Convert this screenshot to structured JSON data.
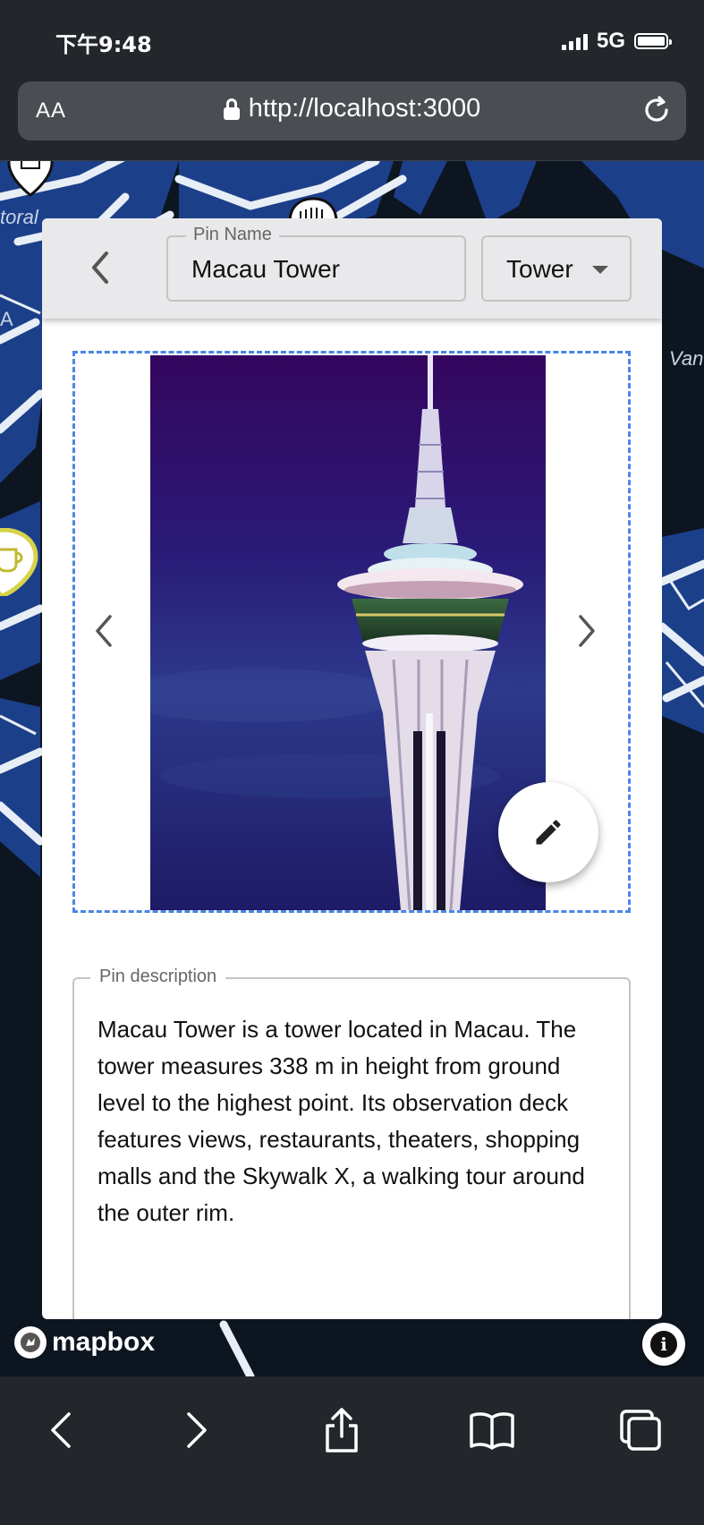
{
  "status_bar": {
    "time": "下午9:48",
    "network": "5G"
  },
  "browser": {
    "text_size_label": "AA",
    "url": "http://localhost:3000"
  },
  "map": {
    "labels": [
      "toral",
      "A",
      "Van"
    ],
    "attribution": "mapbox"
  },
  "pin_card": {
    "name_field": {
      "legend": "Pin Name",
      "value": "Macau Tower"
    },
    "type_select": {
      "value": "Tower"
    },
    "description_field": {
      "legend": "Pin description",
      "value": "Macau Tower is a tower located in Macau. The tower measures 338 m in height from ground level to the highest point. Its observation deck features views, restaurants, theaters, shopping malls and the Skywalk X, a walking tour around the outer rim."
    }
  },
  "colors": {
    "accent_dashed": "#4a86e8",
    "map_water": "#1c3f8a",
    "browser_chrome": "#23272c"
  },
  "icons": [
    "signal-icon",
    "battery-icon",
    "lock-icon",
    "reload-icon",
    "back-arrow-icon",
    "dropdown-caret-icon",
    "chevron-left-icon",
    "chevron-right-icon",
    "pencil-icon",
    "info-icon",
    "share-icon",
    "bookmarks-icon",
    "tabs-icon",
    "coffee-pin-icon",
    "landmark-pin-icon"
  ]
}
